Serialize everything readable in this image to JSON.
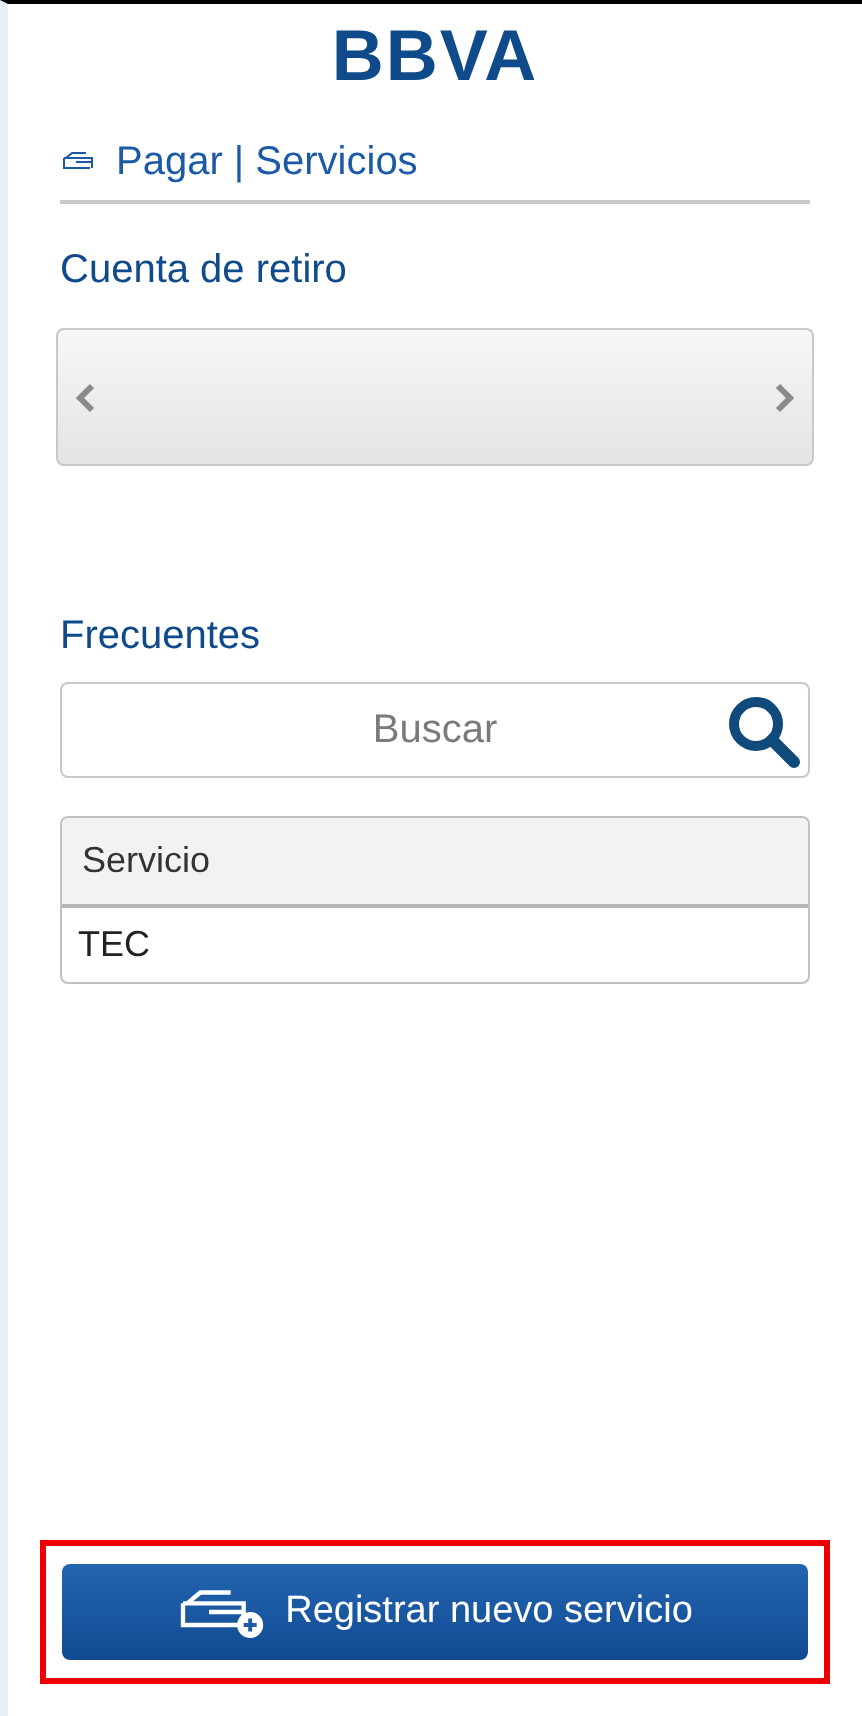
{
  "logo": "BBVA",
  "page_title": "Pagar | Servicios",
  "account_section": {
    "title": "Cuenta de retiro"
  },
  "frequent_section": {
    "title": "Frecuentes",
    "search": {
      "placeholder": "Buscar"
    },
    "table": {
      "columns": [
        "Servicio"
      ],
      "rows": [
        [
          "TEC"
        ]
      ]
    }
  },
  "register_button": {
    "label": "Registrar nuevo servicio",
    "highlighted": true
  }
}
